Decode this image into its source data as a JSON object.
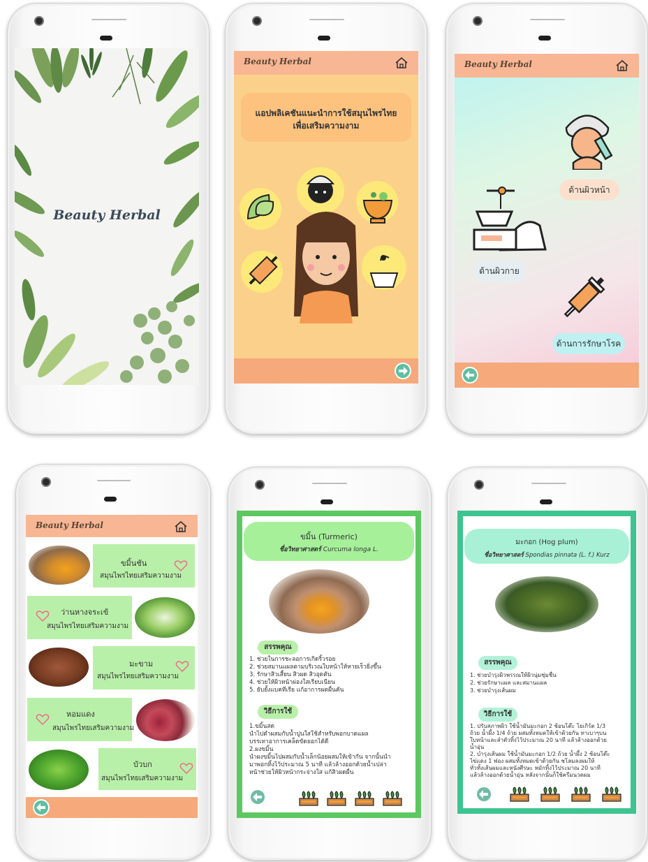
{
  "brand": "Beauty Herbal",
  "intro": {
    "headline_line1": "แอปพลิเคชันแนะนำการใช้สมุนไพรไทย",
    "headline_line2": "เพื่อเสริมความงาม"
  },
  "categories": {
    "face": "ด้านผิวหน้า",
    "body": "ด้านผิวกาย",
    "treatment": "ด้านการรักษาโรค"
  },
  "herb_list": [
    {
      "name": "ขมิ้นชัน",
      "subtitle": "สมุนไพรไทยเสริมความงาม"
    },
    {
      "name": "ว่านหางจระเข้",
      "subtitle": "สมุนไพรไทยเสริมความงาม"
    },
    {
      "name": "มะขาม",
      "subtitle": "สมุนไพรไทยเสริมความงาม"
    },
    {
      "name": "หอมแดง",
      "subtitle": "สมุนไพรไทยเสริมความงาม"
    },
    {
      "name": "บัวบก",
      "subtitle": "สมุนไพรไทยเสริมความงาม"
    }
  ],
  "turmeric": {
    "title": "ขมิ้น (Turmeric)",
    "sci_label": "ชื่อวิทยาศาสตร์",
    "sci_name": "Curcuma longa L.",
    "benefits_label": "สรรพคุณ",
    "benefits": [
      "1. ช่วยในการชะลอการเกิดริ้วรอย",
      "2. ช่วยสมานแผลตามบริเวณใบหน้าให้หายเร็วยิ่งขึ้น",
      "3. รักษาสิวเสี้ยน สิวผด สิวอุดตัน",
      "4. ช่วยให้ผิวหน้าผ่องใสเรียบเนียน",
      "5. ยับยั้งแบคทีเรีย แก้อาการผดผื่นคัน"
    ],
    "usage_label": "วิธีการใช้",
    "usage": [
      "1.ขมิ้นสด",
      "นำไปตำผสมกับน้ำปูนใสใช้สำหรับพอกบาดแผล",
      "บรรเทาอาการเคล็ดขัดยอกได้ดี",
      "2.ผงขมิ้น",
      "นำผงขมิ้นไปผสมกับน้ำเล็กน้อยผสมให้เข้ากัน จากนั้นนำ",
      "มาพอกทิ้งไว้ประมาณ 5 นาที แล้วล้างออกด้วยน้ำเปล่า",
      "หน้าช่วยให้ผิวหน้ากระจ่างใส แก้สิวผดผื่น"
    ]
  },
  "hogplum": {
    "title": "มะกอก (Hog plum)",
    "sci_label": "ชื่อวิทยาศาสตร์",
    "sci_name": "Spondias pinnata (L. f.) Kurz",
    "benefits_label": "สรรพคุณ",
    "benefits": [
      "1. ช่วยบำรุงผิวพรรณให้ผิวนุ่มชุ่มชื่น",
      "2. ช่วยรักษาแผล และสมานแผล",
      "3. ช่วยบำรุงเส้นผม"
    ],
    "usage_label": "วิธีการใช้",
    "usage": [
      "1. ปรับสภาพผิว ใช้น้ำมันมะกอก 2 ช้อนโต๊ะ โยเกิร์ต 1/3",
      "ถ้วย น้ำผึ้ง 1/4 ถ้วย ผสมทั้งหมดให้เข้าด้วยกัน ทาเบาๆบน",
      "ใบหน้าและลำตัวทิ้งไว้ประมาณ 20 นาที แล้วล้างออกด้วย",
      "น้ำอุ่น",
      "2. บำรุงเส้นผม ใช้น้ำมันมะกอก 1/2 ถ้วย น้ำผึ้ง 2 ช้อนโต๊ะ",
      "ไข่แดง 1 ฟอง ผสมทั้งหมดเข้าด้วยกัน ชโลมลงผมให้",
      "ทั่วทั้งเส้นผมและหนังศีรษะ หมักทิ้งไว้ประมาณ 20 นาที",
      "แล้วล้างออกด้วยน้ำอุ่น หลังจากนั้นก็ใช้ครีมนวดผม"
    ]
  },
  "colors": {
    "appbar": "#f8b694",
    "footer": "#f6a97a",
    "intro_bg": "#fbd08b",
    "card_green": "#b9f0a9",
    "frame_green": "#5cc860",
    "teal_button": "#5fbfa0"
  }
}
